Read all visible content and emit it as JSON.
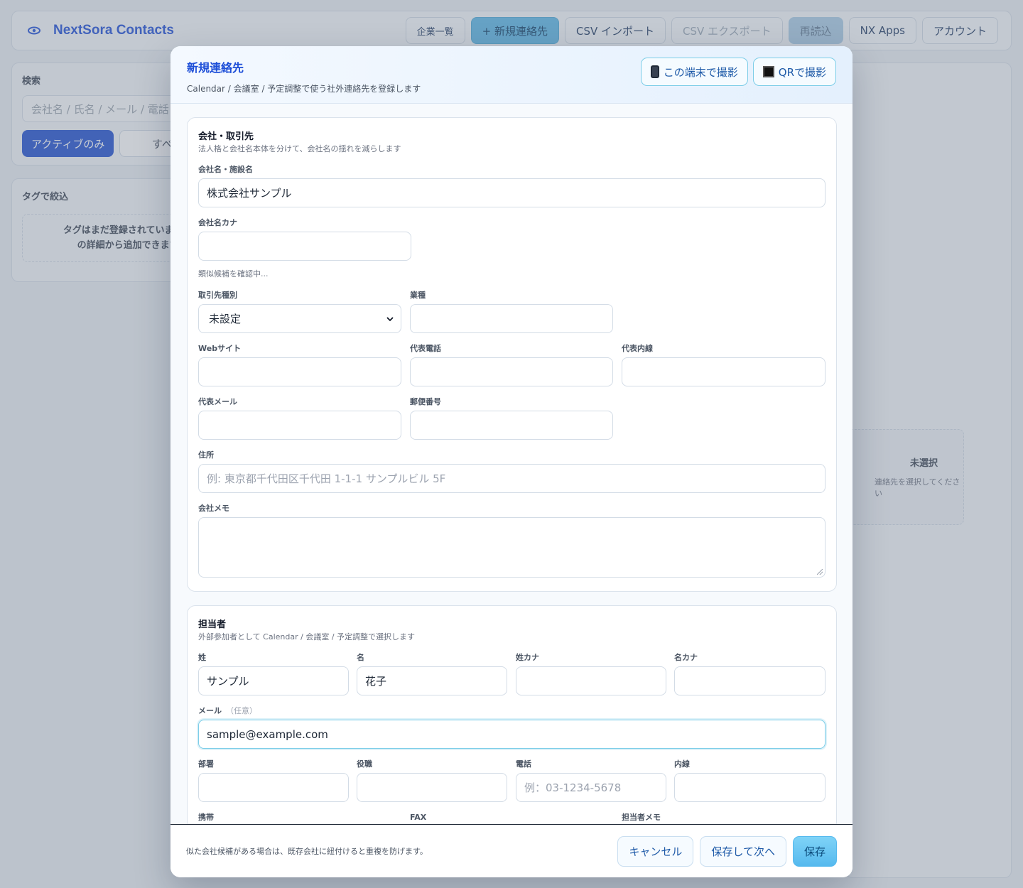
{
  "app": {
    "title": "NextSora Contacts",
    "nav": [
      "企業一覧",
      "+ 新規連絡先",
      "CSV インポート",
      "CSV エクスポート",
      "再読込",
      "NX Apps",
      "アカウント"
    ]
  },
  "sidebar": {
    "search_label": "検索",
    "search_placeholder": "会社名 / 氏名 / メール / 電話",
    "filter_active": "アクティブのみ",
    "filter_all": "すべ",
    "tags_label": "タグで絞込",
    "tags_empty_line1": "タグはまだ登録されていません。",
    "tags_empty_line2": "の詳細から追加できます。"
  },
  "detail": {
    "unselected_title": "未選択",
    "unselected_hint": "連絡先を選択してください"
  },
  "modal": {
    "title": "新規連絡先",
    "subtitle": "Calendar / 会議室 / 予定調整で使う社外連絡先を登録します",
    "capture_device": "この端末で撮影",
    "capture_qr": "QRで撮影",
    "company": {
      "title": "会社・取引先",
      "desc": "法人格と会社名本体を分けて、会社名の揺れを減らします",
      "name_label": "会社名・施設名",
      "name_value": "株式会社サンプル",
      "kana_label": "会社名カナ",
      "kana_value": "",
      "similar_hint": "類似候補を確認中...",
      "type_label": "取引先種別",
      "type_value": "未設定",
      "industry_label": "業種",
      "website_label": "Webサイト",
      "phone_label": "代表電話",
      "ext_label": "代表内線",
      "email_label": "代表メール",
      "zip_label": "郵便番号",
      "address_label": "住所",
      "address_placeholder": "例: 東京都千代田区千代田 1-1-1 サンプルビル 5F",
      "memo_label": "会社メモ"
    },
    "person": {
      "title": "担当者",
      "desc": "外部参加者として Calendar / 会議室 / 予定調整で選択します",
      "last_label": "姓",
      "last_value": "サンプル",
      "first_label": "名",
      "first_value": "花子",
      "last_kana_label": "姓カナ",
      "first_kana_label": "名カナ",
      "email_label": "メール",
      "email_optional": "（任意）",
      "email_value": "sample@example.com",
      "dept_label": "部署",
      "title_label": "役職",
      "phone_label": "電話",
      "phone_placeholder": "例：03-1234-5678",
      "ext_label": "内線",
      "mobile_label": "携帯",
      "fax_label": "FAX",
      "memo_label": "担当者メモ"
    },
    "footer": {
      "note": "似た会社候補がある場合は、既存会社に紐付けると重複を防げます。",
      "cancel": "キャンセル",
      "save_next": "保存して次へ",
      "save": "保存"
    }
  },
  "colors": {
    "brand": "#1d4ed8",
    "accent": "#55b9ee",
    "active_filter": "#1e4fd0"
  }
}
